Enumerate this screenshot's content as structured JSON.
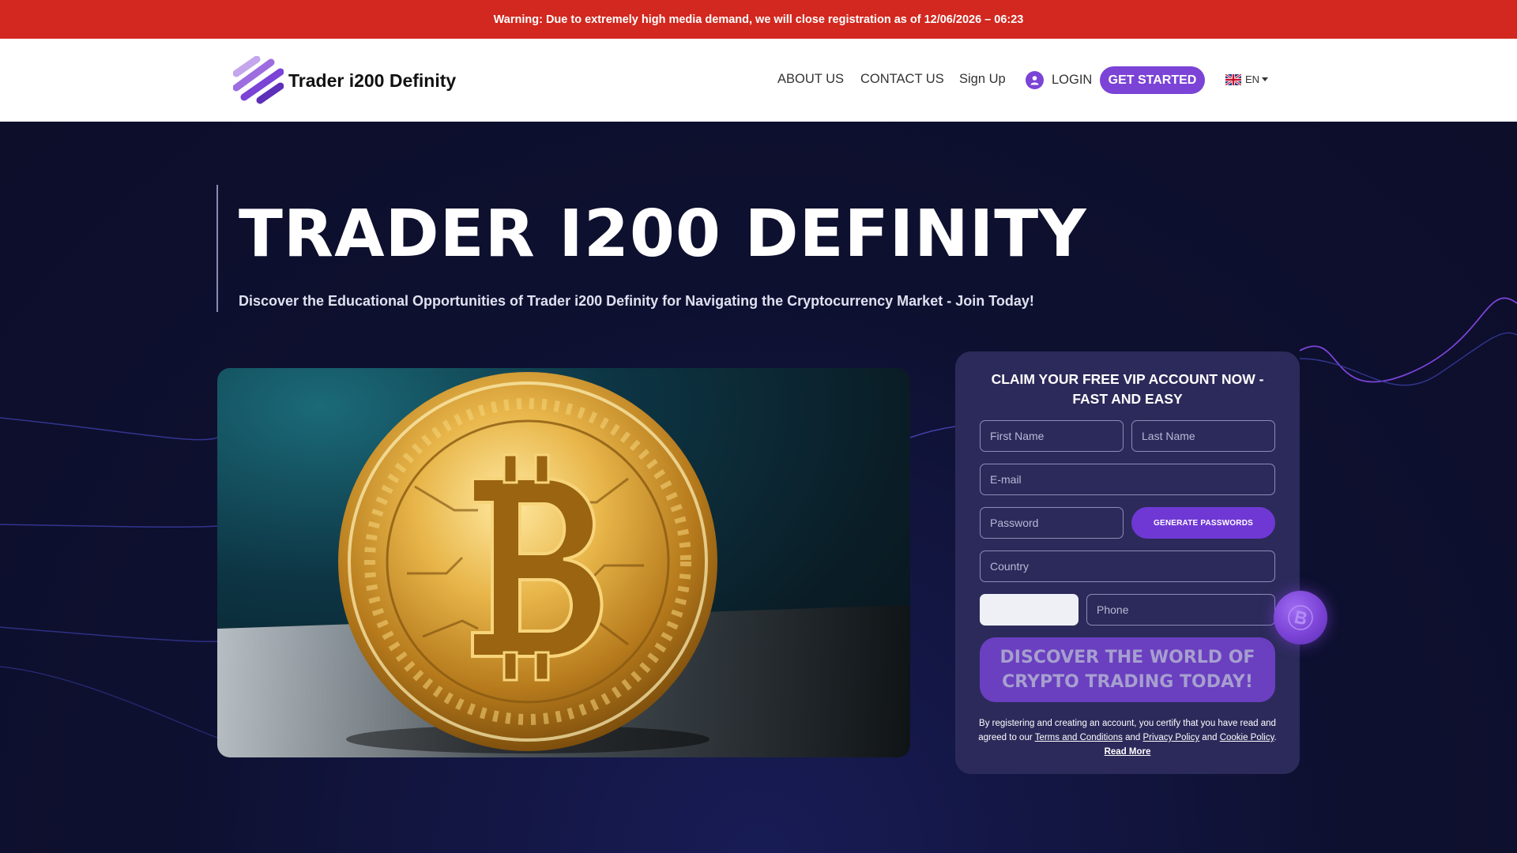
{
  "warning": {
    "text": "Warning: Due to extremely high media demand, we will close registration as of 12/06/2026 – 06:23"
  },
  "header": {
    "logo_text": "Trader i200 Definity",
    "nav": {
      "about": "ABOUT US",
      "contact": "CONTACT US",
      "signup": "Sign Up",
      "login": "LOGIN",
      "get_started": "GET STARTED",
      "language": "EN"
    }
  },
  "hero": {
    "title": "TRADER I200 DEFINITY",
    "subtitle": "Discover the Educational Opportunities of Trader i200 Definity for Navigating the Cryptocurrency Market - Join Today!"
  },
  "form": {
    "title": "CLAIM YOUR FREE VIP ACCOUNT NOW - FAST AND EASY",
    "first_name_placeholder": "First Name",
    "last_name_placeholder": "Last Name",
    "email_placeholder": "E-mail",
    "password_placeholder": "Password",
    "generate_label": "GENERATE PASSWORDS",
    "country_placeholder": "Country",
    "phone_code_value": "",
    "phone_placeholder": "Phone",
    "submit_label": "DISCOVER THE WORLD OF CRYPTO TRADING TODAY!",
    "disclaimer": {
      "intro": "By registering and creating an account, you certify that you have read and agreed to our",
      "terms": "Terms and Conditions",
      "and1": "and",
      "privacy": "Privacy Policy",
      "and2": "and",
      "cookie": "Cookie Policy",
      "dot": ".",
      "read_more": "Read More"
    }
  },
  "icons": {
    "logo": "striped-logo-icon",
    "login": "user-icon",
    "language_flag": "uk-flag-icon",
    "floating": "bitcoin-coin-icon"
  },
  "colors": {
    "warning_bg": "#d2281f",
    "accent": "#7b43d6",
    "hero_bg": "#0e1030",
    "form_bg": "#2c2a5a"
  }
}
